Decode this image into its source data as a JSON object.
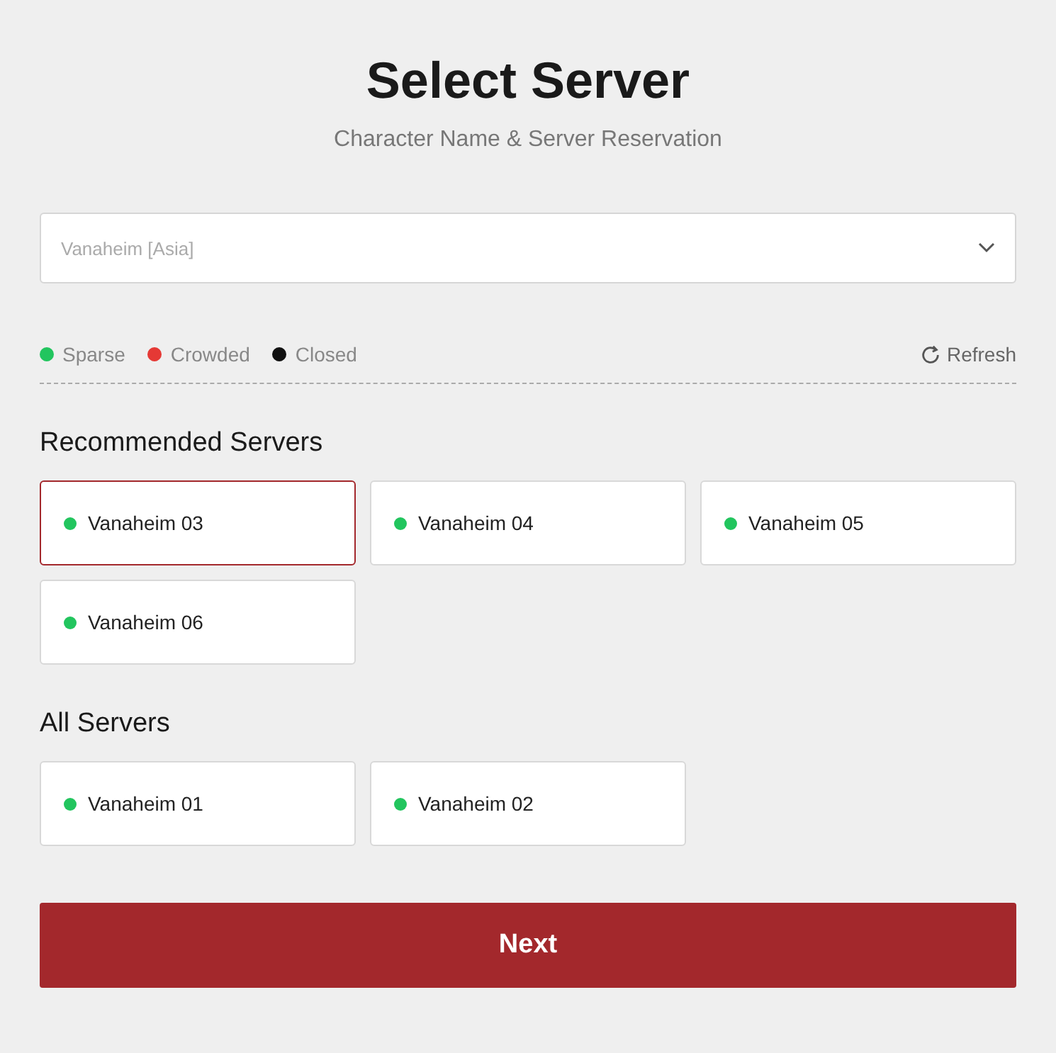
{
  "header": {
    "title": "Select Server",
    "subtitle": "Character Name & Server Reservation"
  },
  "region_select": {
    "value": "Vanaheim [Asia]"
  },
  "legend": [
    {
      "label": "Sparse",
      "color": "#22c55e"
    },
    {
      "label": "Crowded",
      "color": "#e53935"
    },
    {
      "label": "Closed",
      "color": "#111111"
    }
  ],
  "refresh": {
    "label": "Refresh"
  },
  "sections": [
    {
      "title": "Recommended Servers",
      "servers": [
        {
          "name": "Vanaheim 03",
          "color": "#22c55e",
          "selected": true
        },
        {
          "name": "Vanaheim 04",
          "color": "#22c55e",
          "selected": false
        },
        {
          "name": "Vanaheim 05",
          "color": "#22c55e",
          "selected": false
        },
        {
          "name": "Vanaheim 06",
          "color": "#22c55e",
          "selected": false
        }
      ]
    },
    {
      "title": "All Servers",
      "servers": [
        {
          "name": "Vanaheim 01",
          "color": "#22c55e",
          "selected": false
        },
        {
          "name": "Vanaheim 02",
          "color": "#22c55e",
          "selected": false
        }
      ]
    }
  ],
  "next_button": {
    "label": "Next"
  }
}
